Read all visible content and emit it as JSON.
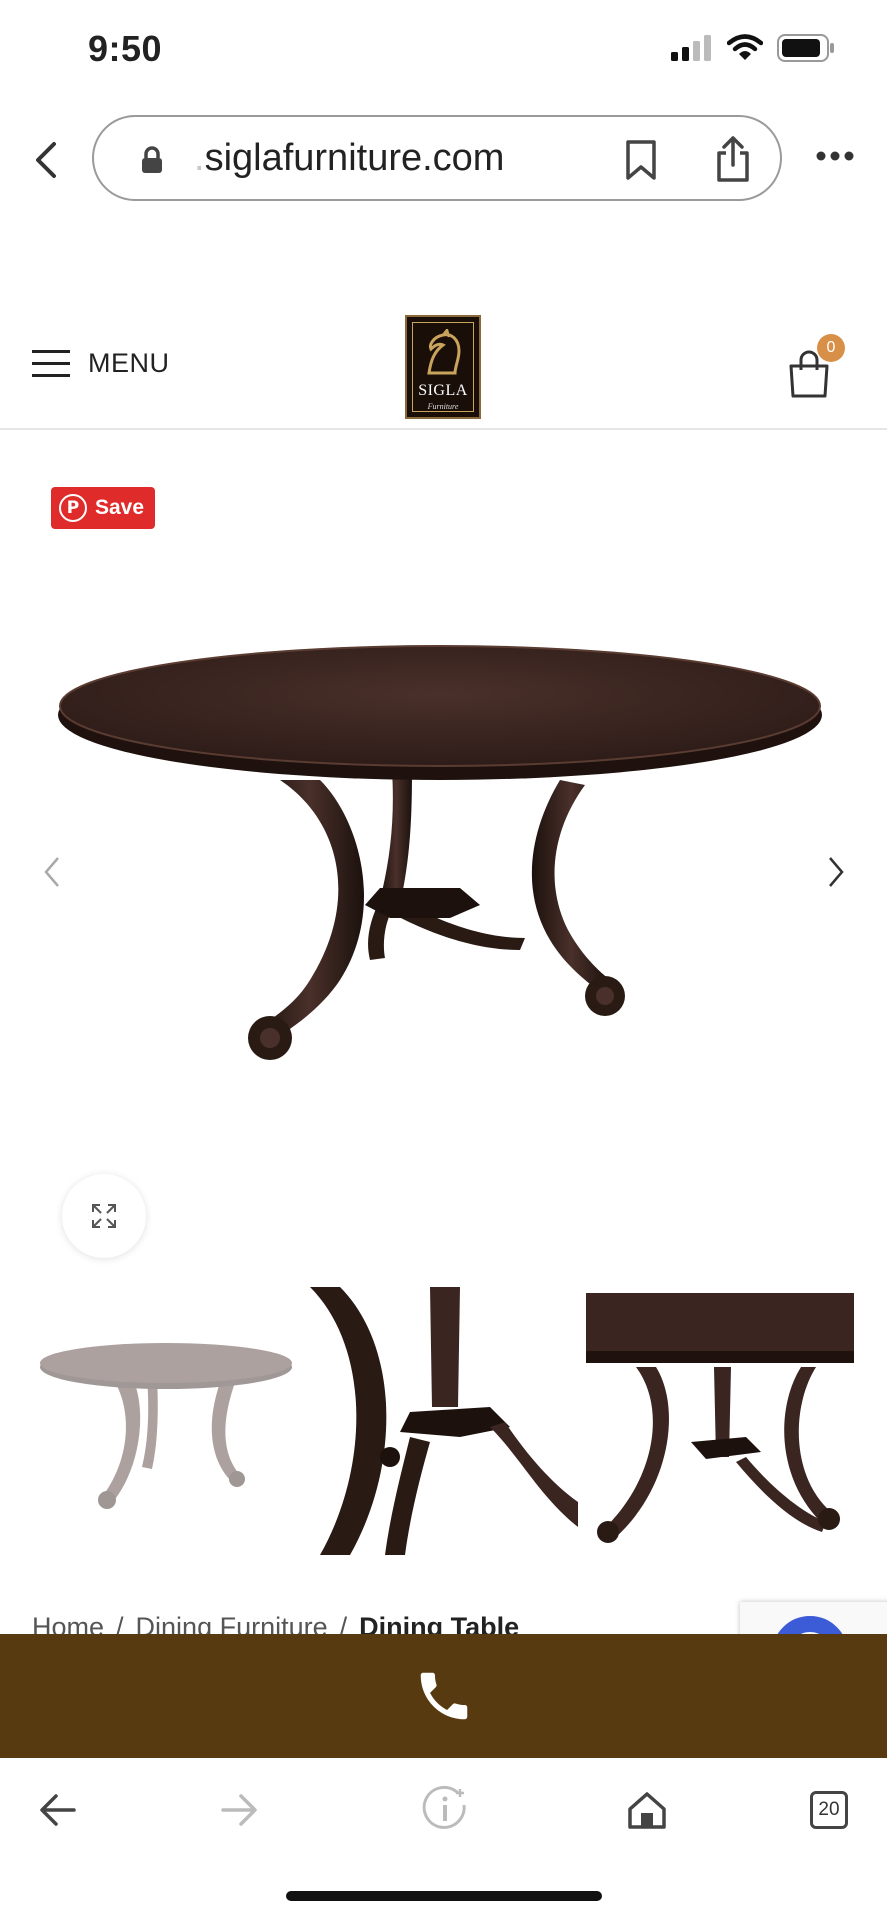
{
  "status_bar": {
    "time": "9:50",
    "icons": [
      "signal-icon",
      "wifi-icon",
      "battery-icon"
    ]
  },
  "browser": {
    "url_prefix": ".",
    "url_text": "siglafurniture.com",
    "icons": [
      "back-chevron-icon",
      "lock-icon",
      "bookmark-icon",
      "share-icon",
      "more-icon"
    ]
  },
  "header": {
    "menu_label": "MENU",
    "logo_text": "SIGLA",
    "logo_subtext": "Furniture",
    "cart_count": "0"
  },
  "gallery": {
    "pinterest_label": "Save",
    "pinterest_glyph": "P",
    "main_image_name": "round dining table",
    "thumbnails": [
      "table-thumb-full",
      "table-thumb-base-detail",
      "table-thumb-angle"
    ]
  },
  "breadcrumb": {
    "items": [
      "Home",
      "Dining Furniture"
    ],
    "separator": "/",
    "current": "Dining Table"
  },
  "call_bar": {
    "icon": "phone-icon",
    "color": "#583a10"
  },
  "toolbar": {
    "icons": [
      "back-arrow-icon",
      "forward-arrow-icon",
      "info-icon",
      "home-icon",
      "tabs-icon"
    ],
    "tabs_count": "20"
  },
  "colors": {
    "accent_cart": "#d89048",
    "pinterest": "#e02b2b",
    "wood_dark": "#3a2520"
  }
}
